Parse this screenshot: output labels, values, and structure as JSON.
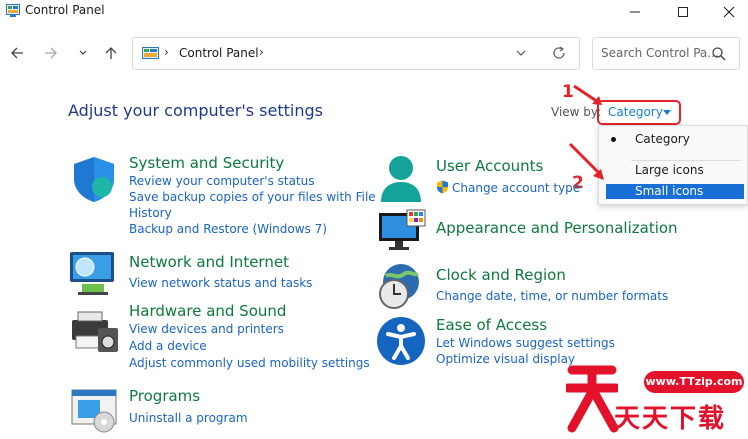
{
  "window": {
    "title": "Control Panel"
  },
  "address": {
    "crumb": "Control Panel",
    "search_placeholder": "Search Control Pa..."
  },
  "heading": "Adjust your computer's settings",
  "view_by": {
    "label": "View by:",
    "value": "Category"
  },
  "view_menu": {
    "items": [
      "Category",
      "Large icons",
      "Small icons"
    ],
    "selected": "Category",
    "highlighted": "Small icons"
  },
  "annotations": [
    "1",
    "2"
  ],
  "categories_left": [
    {
      "title": "System and Security",
      "links": [
        "Review your computer's status",
        "Save backup copies of your files with File",
        "History",
        "Backup and Restore (Windows 7)"
      ],
      "icon": "shield-icon"
    },
    {
      "title": "Network and Internet",
      "links": [
        "View network status and tasks"
      ],
      "icon": "network-icon"
    },
    {
      "title": "Hardware and Sound",
      "links": [
        "View devices and printers",
        "Add a device",
        "Adjust commonly used mobility settings"
      ],
      "icon": "printer-icon"
    },
    {
      "title": "Programs",
      "links": [
        "Uninstall a program"
      ],
      "icon": "programs-icon"
    }
  ],
  "categories_right": [
    {
      "title": "User Accounts",
      "links": [
        "Change account type"
      ],
      "icon": "user-icon"
    },
    {
      "title": "Appearance and Personalization",
      "links": [],
      "icon": "monitor-icon"
    },
    {
      "title": "Clock and Region",
      "links": [
        "Change date, time, or number formats"
      ],
      "icon": "clock-icon"
    },
    {
      "title": "Ease of Access",
      "links": [
        "Let Windows suggest settings",
        "Optimize visual display"
      ],
      "icon": "accessibility-icon"
    }
  ],
  "watermark": {
    "url": "www.TTzip.com",
    "text": "天天下载"
  },
  "colors": {
    "accent": "#1a6fd6",
    "title_green": "#0d7a3c",
    "link_blue": "#1a64c4",
    "annotation_red": "#e4222a"
  }
}
